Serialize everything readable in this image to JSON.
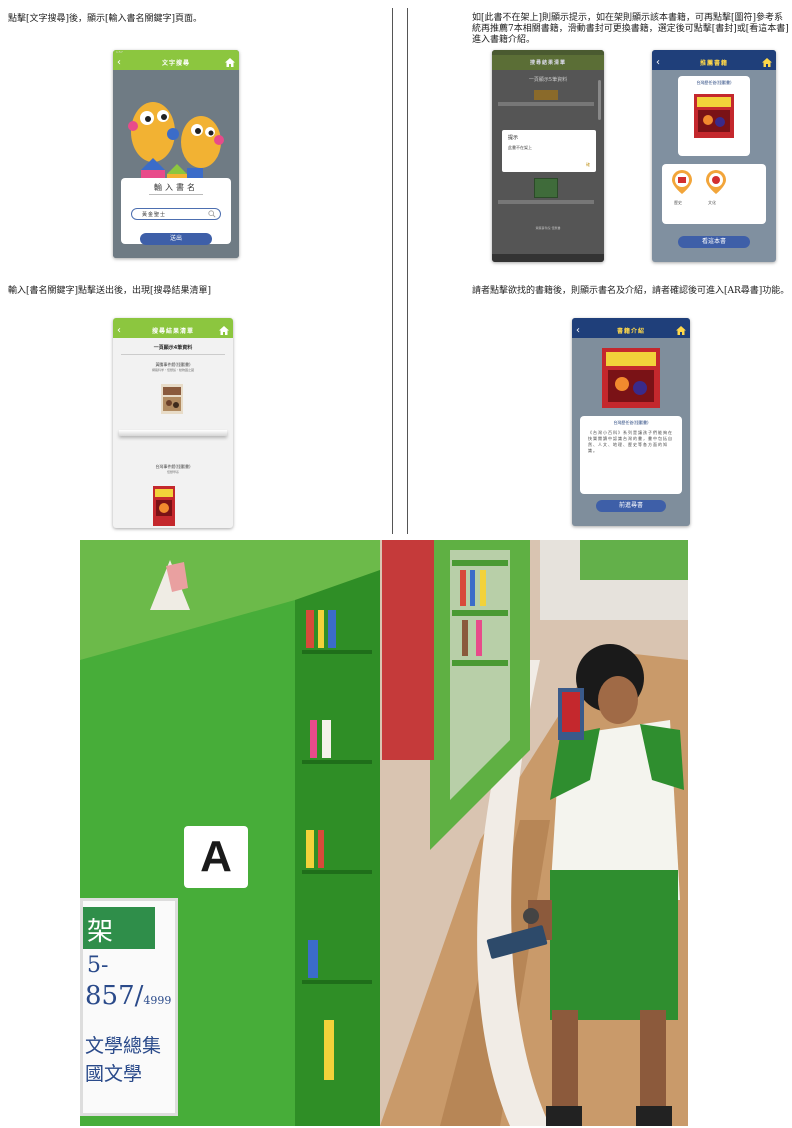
{
  "captions": {
    "top_left": "點擊[文字搜尋]後，顯示[輸入書名關鍵字]頁面。",
    "top_right": "如[此書不在架上]則顯示提示，如在架則顯示該本書籍，可再點擊[圖符]參考系統再推薦7本相關書籍，滑動書封可更換書籍，選定後可點擊[書封]或[看這本書]進入書籍介紹。",
    "mid_left": "輸入[書名關鍵字]點擊送出後，出現[搜尋結果清單]",
    "mid_right": "請者點擊欲找的書籍後，則顯示書名及介紹，請者確認後可進入[AR尋書]功能。"
  },
  "screen1": {
    "title": "文字搜尋",
    "prompt": "輸入書名",
    "input_value": "黃金聖士",
    "submit": "送出",
    "status": "1:57"
  },
  "screen2": {
    "title": "搜尋結果清單",
    "count": "一頁顯示4筆資料",
    "result1_title": "黃騰事件館(怪獸書)",
    "result1_sub": "網路科学・怪獸館・動物園之國",
    "result2_title": "台灣事件館(怪獸書)",
    "result2_sub": "怪獸學系"
  },
  "screen3": {
    "title": "搜尋結果清單",
    "count": "一頁顯示5筆資料",
    "dialog_title": "提示",
    "dialog_body": "此書不在架上",
    "dialog_ok": "確",
    "footer": "黃騰事件館 怪獸書"
  },
  "screen4": {
    "title": "推薦書籍",
    "book_title": "台灣歷任爸(怪獸書)",
    "icon1": "歷史",
    "icon2": "文化",
    "button": "看這本書"
  },
  "screen5": {
    "title": "書籍介紹",
    "book_title": "台灣歷任爸(怪獸書)",
    "desc": "《台灣小百科》系列是讓孩子們能夠在快樂閱讀中認識台灣的書，書中包括自然、人文、地理、歷史等各方面的知識。",
    "button": "前進尋書"
  },
  "photo": {
    "shelf_letter": "A",
    "sign_line1": "架",
    "sign_line2": "5-",
    "sign_line3": "857/",
    "sign_small": "4999",
    "sign_line4": "文學總集",
    "sign_line5": "國文學"
  }
}
